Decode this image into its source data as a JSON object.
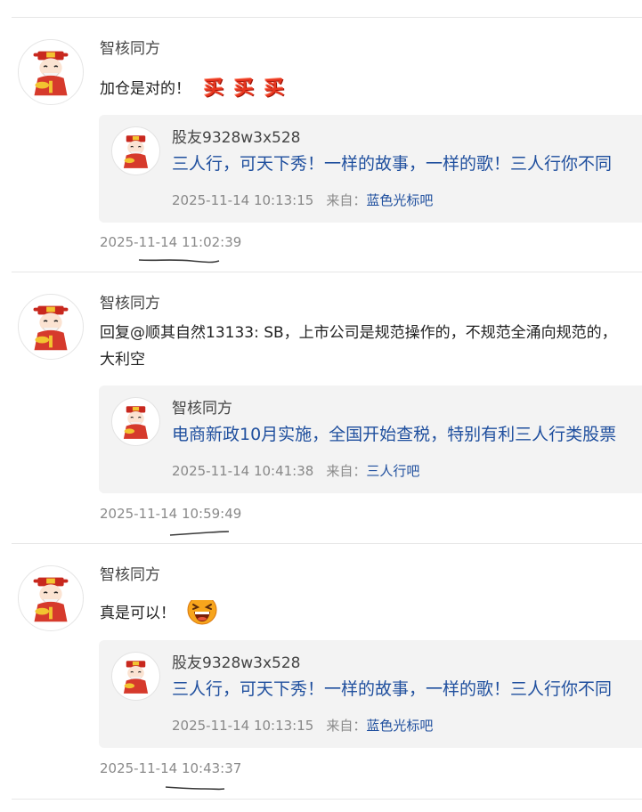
{
  "posts": [
    {
      "author": "智核同方",
      "content_lines": [
        "加仓是对的！"
      ],
      "stickers": [
        "买",
        "买",
        "买"
      ],
      "quote": {
        "author": "股友9328w3x528",
        "text": "三人行，可天下秀！一样的故事，一样的歌！三人行你不同",
        "time": "2025-11-14 10:13:15",
        "from_label": "来自：",
        "forum": "蓝色光标吧"
      },
      "timestamp": "2025-11-14 11:02:39"
    },
    {
      "author": "智核同方",
      "content_lines": [
        "回复@顺其自然13133: SB，上市公司是规范操作的，不规范全涌向规范的，",
        "大利空"
      ],
      "quote": {
        "author": "智核同方",
        "text": "电商新政10月实施，全国开始查税，特别有利三人行类股票",
        "time": "2025-11-14 10:41:38",
        "from_label": "来自：",
        "forum": "三人行吧"
      },
      "timestamp": "2025-11-14 10:59:49"
    },
    {
      "author": "智核同方",
      "content_lines": [
        "真是可以！"
      ],
      "emoji": "laughing-emoji",
      "quote": {
        "author": "股友9328w3x528",
        "text": "三人行，可天下秀！一样的故事，一样的歌！三人行你不同",
        "time": "2025-11-14 10:13:15",
        "from_label": "来自：",
        "forum": "蓝色光标吧"
      },
      "timestamp": "2025-11-14 10:43:37"
    }
  ],
  "icons": {
    "avatar": "caishen-avatar-icon"
  },
  "colors": {
    "link_blue": "#1f4f9e",
    "meta_gray": "#888888",
    "quote_bg": "#f3f3f3",
    "sticker_red": "#e8361f"
  }
}
